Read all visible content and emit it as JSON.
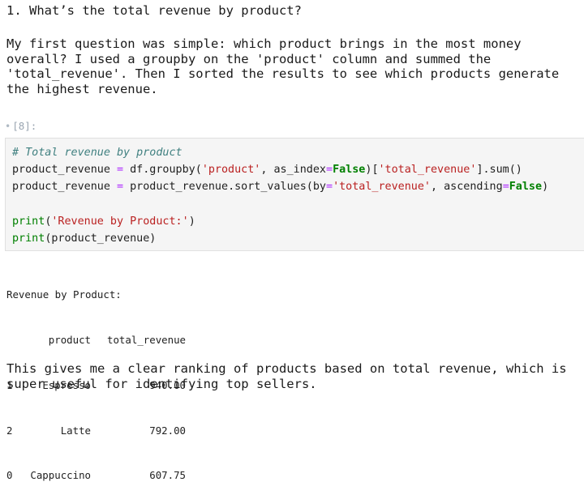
{
  "markdown": {
    "heading": "1. What’s the total revenue by product?",
    "paragraph1": "My first question was simple: which product brings in the most money overall? I used a groupby on the 'product' column and summed the 'total_revenue'. Then I sorted the results to see which products generate the highest revenue.",
    "paragraph2": "This gives me a clear ranking of products based on total revenue, which is super useful for identifying top sellers."
  },
  "cell": {
    "prompt": "[8]:",
    "code": {
      "comment": "# Total revenue by product",
      "line2": {
        "var": "product_revenue",
        "op": "=",
        "obj": "df",
        "method": ".groupby(",
        "arg_str": "'product'",
        "sep": ", as_index",
        "eq": "=",
        "kw": "False",
        "close": ")",
        "bracket_open": "[",
        "key_str": "'total_revenue'",
        "bracket_close": "]",
        "tail": ".sum()"
      },
      "line3": {
        "var": "product_revenue",
        "op": "=",
        "obj": "product_revenue",
        "method": ".sort_values(by",
        "eq1": "=",
        "by_str": "'total_revenue'",
        "sep": ", ascending",
        "eq2": "=",
        "kw": "False",
        "close": ")"
      },
      "line5": {
        "fn": "print",
        "open": "(",
        "str": "'Revenue by Product:'",
        "close": ")"
      },
      "line6": {
        "fn": "print",
        "rest": "(product_revenue)"
      }
    }
  },
  "output": {
    "title": "Revenue by Product:",
    "header": {
      "index": "",
      "product": "product",
      "total_revenue": "total_revenue"
    },
    "rows": [
      {
        "index": "1",
        "product": "Espresso",
        "total_revenue": "940.00"
      },
      {
        "index": "2",
        "product": "Latte",
        "total_revenue": "792.00"
      },
      {
        "index": "0",
        "product": "Cappuccino",
        "total_revenue": "607.75"
      }
    ]
  }
}
